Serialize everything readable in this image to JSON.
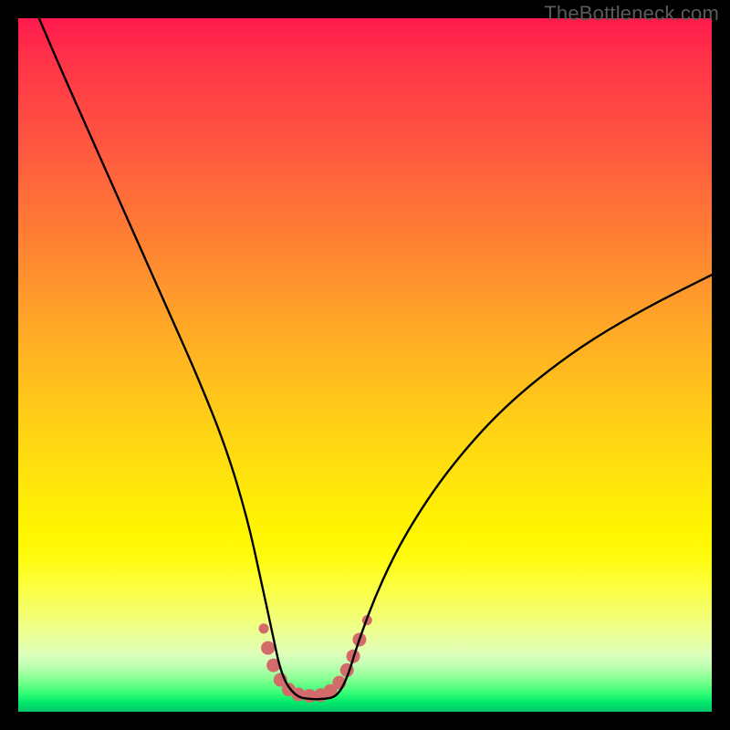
{
  "attribution": "TheBottleneck.com",
  "chart_data": {
    "type": "line",
    "title": "",
    "xlabel": "",
    "ylabel": "",
    "xlim": [
      0,
      100
    ],
    "ylim": [
      0,
      100
    ],
    "grid": false,
    "legend": false,
    "series": [
      {
        "name": "bottleneck-curve",
        "note": "V-shaped curve; normalized 0-100 coordinates (origin bottom-left). Steep left arm from ~(3,100) to trough, flat trough ~38-46 at y≈2, gentler right arm rising to ~(100,63).",
        "x": [
          3,
          6,
          10,
          14,
          18,
          22,
          26,
          30,
          33,
          35,
          36.5,
          38,
          40,
          42,
          44,
          46,
          47.5,
          49,
          52,
          56,
          62,
          70,
          80,
          90,
          100
        ],
        "y": [
          100,
          93,
          84,
          75,
          66,
          57,
          48,
          38,
          28,
          19,
          12,
          5,
          2.2,
          1.8,
          1.8,
          2.2,
          5,
          10,
          18,
          26,
          35,
          44,
          52,
          58,
          63
        ]
      }
    ],
    "markers": {
      "name": "trough-marker-chain",
      "color": "#d46b6b",
      "radius_main": 7.5,
      "radius_end": 5.5,
      "note": "Chain of pink/salmon dots lining the trough of the V, slightly above the curve line.",
      "points_norm": [
        {
          "x": 35.4,
          "y": 12.0,
          "r": 5.5
        },
        {
          "x": 36.0,
          "y": 9.2,
          "r": 7.5
        },
        {
          "x": 36.8,
          "y": 6.7,
          "r": 7.5
        },
        {
          "x": 37.8,
          "y": 4.6,
          "r": 7.5
        },
        {
          "x": 39.0,
          "y": 3.2,
          "r": 7.5
        },
        {
          "x": 40.4,
          "y": 2.5,
          "r": 7.5
        },
        {
          "x": 42.0,
          "y": 2.3,
          "r": 7.5
        },
        {
          "x": 43.6,
          "y": 2.4,
          "r": 7.5
        },
        {
          "x": 45.0,
          "y": 3.0,
          "r": 7.5
        },
        {
          "x": 46.3,
          "y": 4.2,
          "r": 7.5
        },
        {
          "x": 47.4,
          "y": 6.0,
          "r": 7.5
        },
        {
          "x": 48.3,
          "y": 8.0,
          "r": 7.5
        },
        {
          "x": 49.2,
          "y": 10.4,
          "r": 7.5
        },
        {
          "x": 50.3,
          "y": 13.2,
          "r": 5.5
        }
      ]
    },
    "background": {
      "type": "vertical-gradient",
      "stops": [
        {
          "pos": 0.0,
          "color": "#ff1a4d"
        },
        {
          "pos": 0.5,
          "color": "#ffb820"
        },
        {
          "pos": 0.75,
          "color": "#fff500"
        },
        {
          "pos": 0.92,
          "color": "#dfffb8"
        },
        {
          "pos": 1.0,
          "color": "#05c66b"
        }
      ]
    }
  }
}
